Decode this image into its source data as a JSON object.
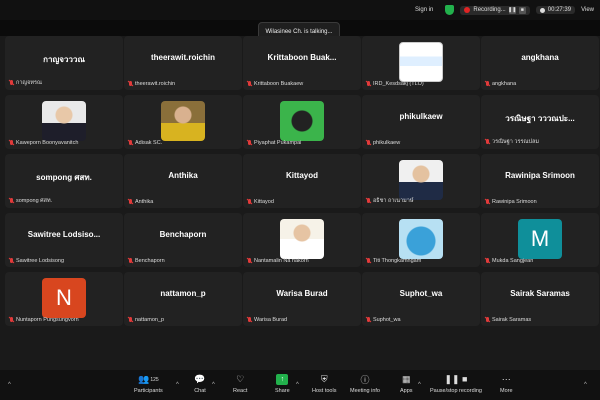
{
  "topbar": {
    "talking": "Wilasinee Ch. is talking...",
    "signin": "Sign in",
    "recording": "Recording...",
    "timer": "00:27:39",
    "view": "View"
  },
  "tiles": [
    {
      "name": "กาญจวววณ",
      "label": "กาญจทรณ"
    },
    {
      "name": "theerawit.roichin",
      "label": "theerawit.roichin"
    },
    {
      "name": "Krittaboon  Buak...",
      "label": "Krittaboon Buakaew"
    },
    {
      "name": "",
      "label": "IRD_Kesdsak​j (TLO)",
      "image": "ird-logo"
    },
    {
      "name": "angkhana",
      "label": "angkhana"
    },
    {
      "name": "",
      "label": "Kaweporn Boonyavanitch",
      "image": "photo-woman"
    },
    {
      "name": "",
      "label": "Adisak SC.",
      "image": "photo-man"
    },
    {
      "name": "",
      "label": "Piyaphat Pukampai",
      "image": "dog-cartoon"
    },
    {
      "name": "phikulkaew",
      "label": "phikulkaew"
    },
    {
      "name": "วรณิษฐา  วววณปะ...",
      "label": "วรณิษฐา วรรณปลม"
    },
    {
      "name": "sompong  ศสท.",
      "label": "sompong ศสท."
    },
    {
      "name": "Anthika",
      "label": "Anthika"
    },
    {
      "name": "Kittayod",
      "label": "Kittayod"
    },
    {
      "name": "",
      "label": "อธิชา ถาเนามาษ์",
      "image": "photo-woman2"
    },
    {
      "name": "Rawinipa Srimoon",
      "label": "Rawinipa Srimoon"
    },
    {
      "name": "Sawitree  Lodsiso...",
      "label": "Sawitree Lodsisong"
    },
    {
      "name": "Benchaporn",
      "label": "Benchaporn"
    },
    {
      "name": "",
      "label": "Nantamalin Na nakorn",
      "image": "photo-uniform"
    },
    {
      "name": "",
      "label": "Titi Thongkamngam",
      "image": "whale"
    },
    {
      "name": "",
      "label": "Mukda Sangjean",
      "letter": "M",
      "color": "#0f8f9a"
    },
    {
      "name": "",
      "label": "Nuntaporn Pungsungvorn",
      "letter": "N",
      "color": "#d8461f"
    },
    {
      "name": "nattamon_p",
      "label": "nattamon_p"
    },
    {
      "name": "Warisa Burad",
      "label": "Warisa Burad"
    },
    {
      "name": "Suphot_wa",
      "label": "Suphot_wa"
    },
    {
      "name": "Sairak Saramas",
      "label": "Sairak Saramas"
    }
  ],
  "toolbar": {
    "participants_label": "Participants",
    "participants_count": "125",
    "chat": "Chat",
    "react": "React",
    "share": "Share",
    "host_tools": "Host tools",
    "meeting_info": "Meeting info",
    "apps": "Apps",
    "pause_stop": "Pause/stop recording",
    "more": "More"
  }
}
